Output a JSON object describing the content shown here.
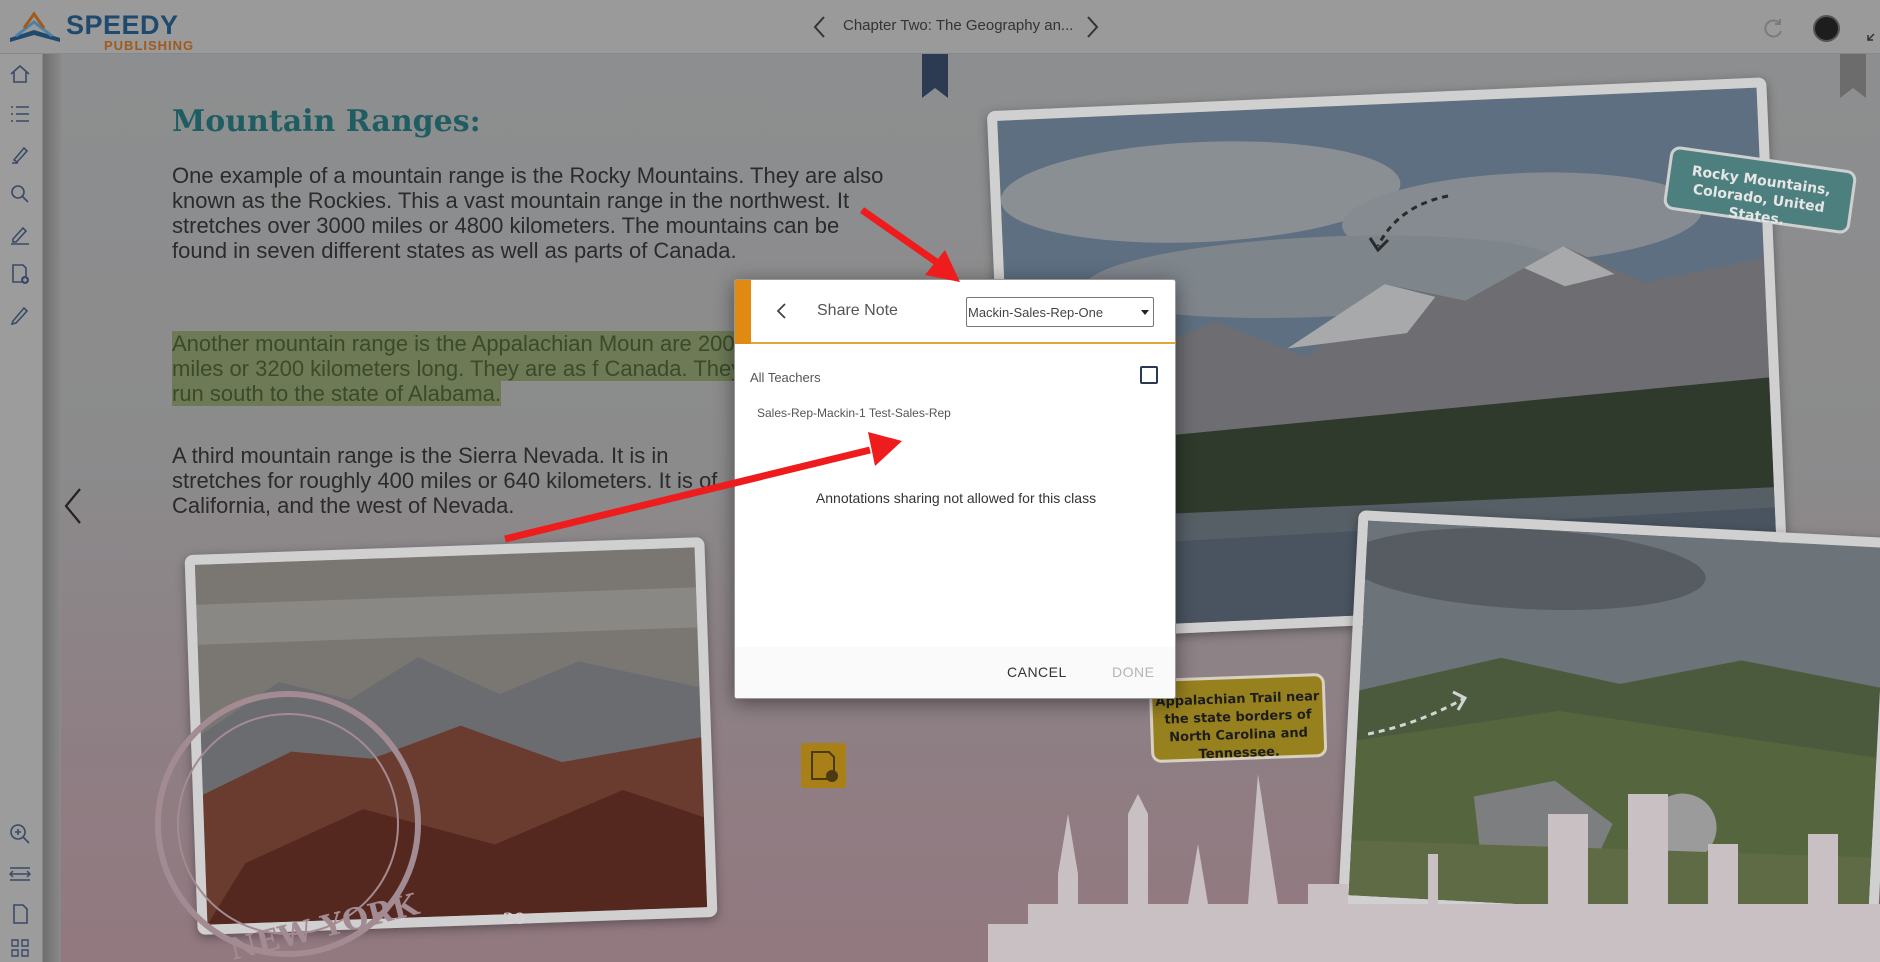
{
  "app": {
    "brand_line1": "SPEEDY",
    "brand_line2": "PUBLISHING",
    "chapter_title": "Chapter Two: The Geography an..."
  },
  "book": {
    "heading": "Mountain Ranges:",
    "paragraph1": "One example of a mountain range is the Rocky Mountains. They are also known as the Rockies. This a vast mountain range in the northwest. It stretches over 3000 miles or 4800 kilometers. The mountains can be found in seven different states as well as parts of Canada.",
    "paragraph2": "Another mountain range is the Appalachian Moun are 2000 miles or 3200 kilometers long. They are as f Canada. They run south to the state of Alabama.",
    "paragraph3": "A third mountain range is the Sierra Nevada. It is in stretches for roughly 400 miles or 640 kilometers. It is of California, and the west of Nevada.",
    "page_number": "20",
    "tag_rocky": "Rocky Mountains, Colorado, United States.",
    "tag_appalachian": "Appalachian Trail near the state borders of North Carolina and Tennessee.",
    "stamp_text": "NEW YORK"
  },
  "dialog": {
    "title": "Share Note",
    "class_select_value": "Mackin-Sales-Rep-One",
    "all_teachers_label": "All Teachers",
    "teacher_name": "Sales-Rep-Mackin-1 Test-Sales-Rep",
    "message": "Annotations sharing not allowed for this class",
    "cancel_label": "CANCEL",
    "done_label": "DONE"
  },
  "toolbar": {
    "tools": [
      "home-icon",
      "toc-icon",
      "highlighter-icon",
      "search-icon",
      "pen-icon",
      "add-note-icon",
      "pencil-icon"
    ],
    "bottom_tools": [
      "zoom-in-icon",
      "fit-width-icon",
      "single-page-icon",
      "grid-view-icon"
    ]
  },
  "colors": {
    "accent_orange": "#e08a12",
    "heading_teal": "#1f5d63",
    "annotation_red": "#ee1c1c"
  }
}
